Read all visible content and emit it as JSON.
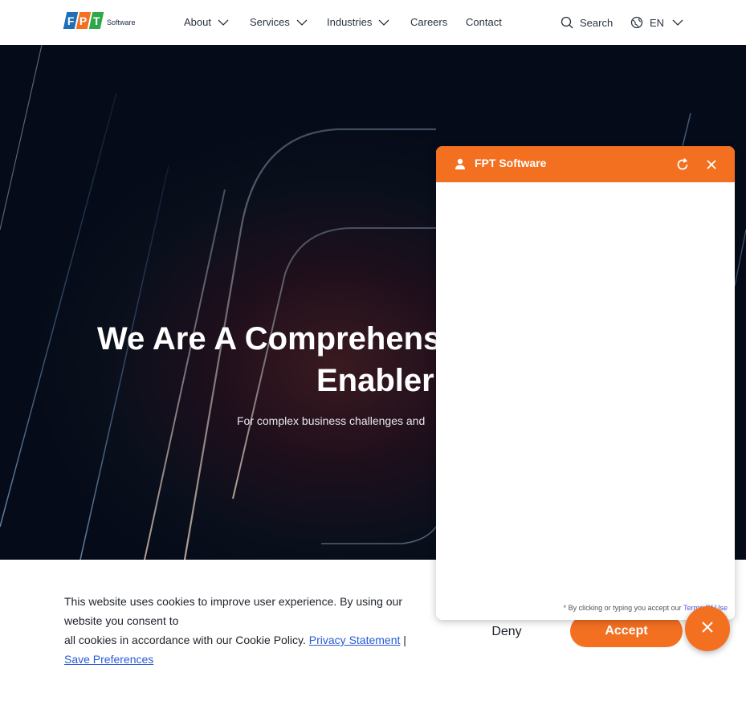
{
  "header": {
    "logo_letters": [
      "F",
      "P",
      "T"
    ],
    "logo_colors": [
      "#1e6fb8",
      "#f37021",
      "#2ba84a"
    ],
    "logo_suffix": "Software",
    "nav": [
      {
        "label": "About",
        "dropdown": true
      },
      {
        "label": "Services",
        "dropdown": true
      },
      {
        "label": "Industries",
        "dropdown": true
      },
      {
        "label": "Careers",
        "dropdown": false
      },
      {
        "label": "Contact",
        "dropdown": false
      }
    ],
    "search_label": "Search",
    "language": "EN"
  },
  "hero": {
    "title_line1": "We Are A Comprehensi",
    "title_line2": "Enabler",
    "subtitle": "For complex business challenges and"
  },
  "cookie": {
    "text_line1": "This website uses cookies to improve user experience. By using our website you consent to",
    "text_line2": "all cookies in accordance with our Cookie Policy.",
    "privacy_link": "Privacy Statement",
    "separator": "|",
    "preferences_link": "Save Preferences",
    "deny_label": "Deny",
    "accept_label": "Accept"
  },
  "chat": {
    "title": "FPT Software",
    "footer_text": "* By clicking or typing you accept our",
    "terms_link": "Terms Of Use"
  },
  "colors": {
    "brand_orange": "#f37021",
    "link_blue": "#2a5ad7"
  }
}
